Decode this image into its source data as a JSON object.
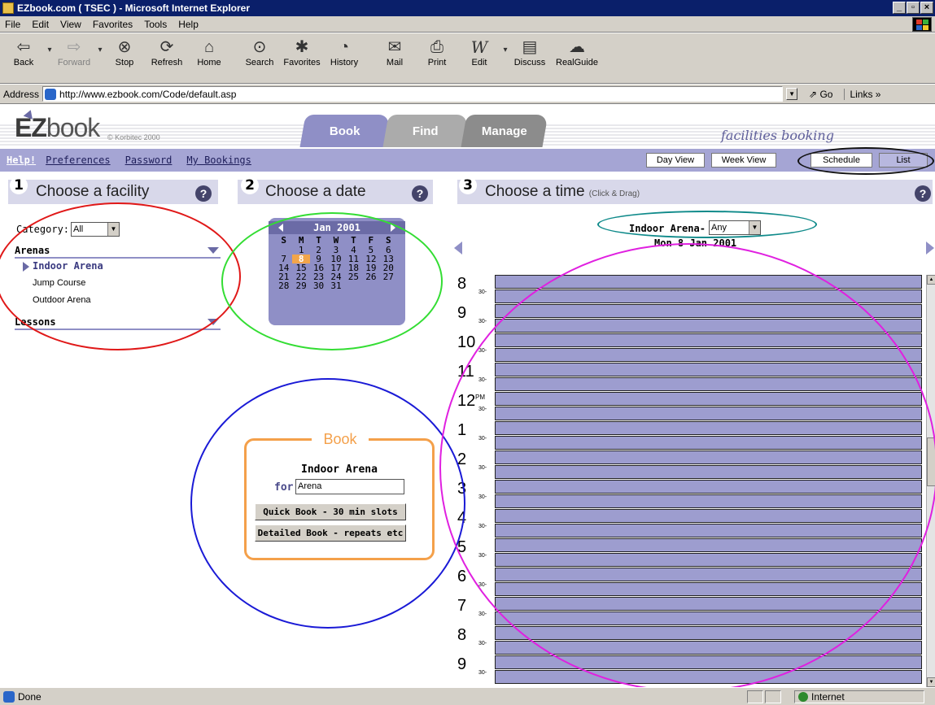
{
  "window": {
    "title": "EZbook.com ( TSEC ) - Microsoft Internet Explorer"
  },
  "menu": [
    "File",
    "Edit",
    "View",
    "Favorites",
    "Tools",
    "Help"
  ],
  "toolbar": {
    "back": "Back",
    "forward": "Forward",
    "stop": "Stop",
    "refresh": "Refresh",
    "home": "Home",
    "search": "Search",
    "favorites": "Favorites",
    "history": "History",
    "mail": "Mail",
    "print": "Print",
    "edit": "Edit",
    "discuss": "Discuss",
    "realguide": "RealGuide"
  },
  "address": {
    "label": "Address",
    "url": "http://www.ezbook.com/Code/default.asp",
    "go": "Go",
    "links": "Links"
  },
  "banner": {
    "logo_ez": "EZ",
    "logo_book": "book",
    "copyright": "© Korbitec 2000",
    "tabs": [
      "Book",
      "Find",
      "Manage"
    ],
    "tagline": "facilities booking"
  },
  "subnav": {
    "help": "Help!",
    "preferences": "Preferences",
    "password": "Password",
    "my_bookings": "My Bookings",
    "day_view": "Day View",
    "week_view": "Week View",
    "schedule": "Schedule",
    "list": "List"
  },
  "section1": {
    "num": "1",
    "title": "Choose a facility",
    "category_label": "Category:",
    "category_value": "All",
    "group_arenas": "Arenas",
    "facilities": [
      "Indoor Arena",
      "Jump Course",
      "Outdoor Arena"
    ],
    "group_lessons": "Lessons"
  },
  "section2": {
    "num": "2",
    "title": "Choose a date",
    "month": "Jan 2001",
    "dow": [
      "S",
      "M",
      "T",
      "W",
      "T",
      "F",
      "S"
    ],
    "days": [
      "",
      "1",
      "2",
      "3",
      "4",
      "5",
      "6",
      "7",
      "8",
      "9",
      "10",
      "11",
      "12",
      "13",
      "14",
      "15",
      "16",
      "17",
      "18",
      "19",
      "20",
      "21",
      "22",
      "23",
      "24",
      "25",
      "26",
      "27",
      "28",
      "29",
      "30",
      "31"
    ],
    "selected_day": "8"
  },
  "book_box": {
    "title": "Book",
    "facility": "Indoor Arena",
    "for_label": "for",
    "for_value": "Arena",
    "quick_book": "Quick Book - 30 min slots",
    "detailed_book": "Detailed Book - repeats etc"
  },
  "section3": {
    "num": "3",
    "title": "Choose a time",
    "hint": "(Click & Drag)",
    "facility_label": "Indoor Arena-",
    "select_value": "Any",
    "date": "Mon 8 Jan 2001",
    "hours": [
      "8",
      "9",
      "10",
      "11",
      "12",
      "1",
      "2",
      "3",
      "4",
      "5",
      "6",
      "7",
      "8",
      "9"
    ],
    "pm_marker": "PM",
    "half_label": "30-"
  },
  "status": {
    "text": "Done",
    "zone": "Internet"
  },
  "help_glyph": "?",
  "colors": {
    "lavender": "#9d9dcf",
    "orange": "#f4a04a",
    "ring_red": "#e01818",
    "ring_green": "#33dd33",
    "ring_blue": "#1a1ad6",
    "ring_magenta": "#e020e0",
    "ring_teal": "#0f8a8a",
    "ring_black": "#111111"
  }
}
